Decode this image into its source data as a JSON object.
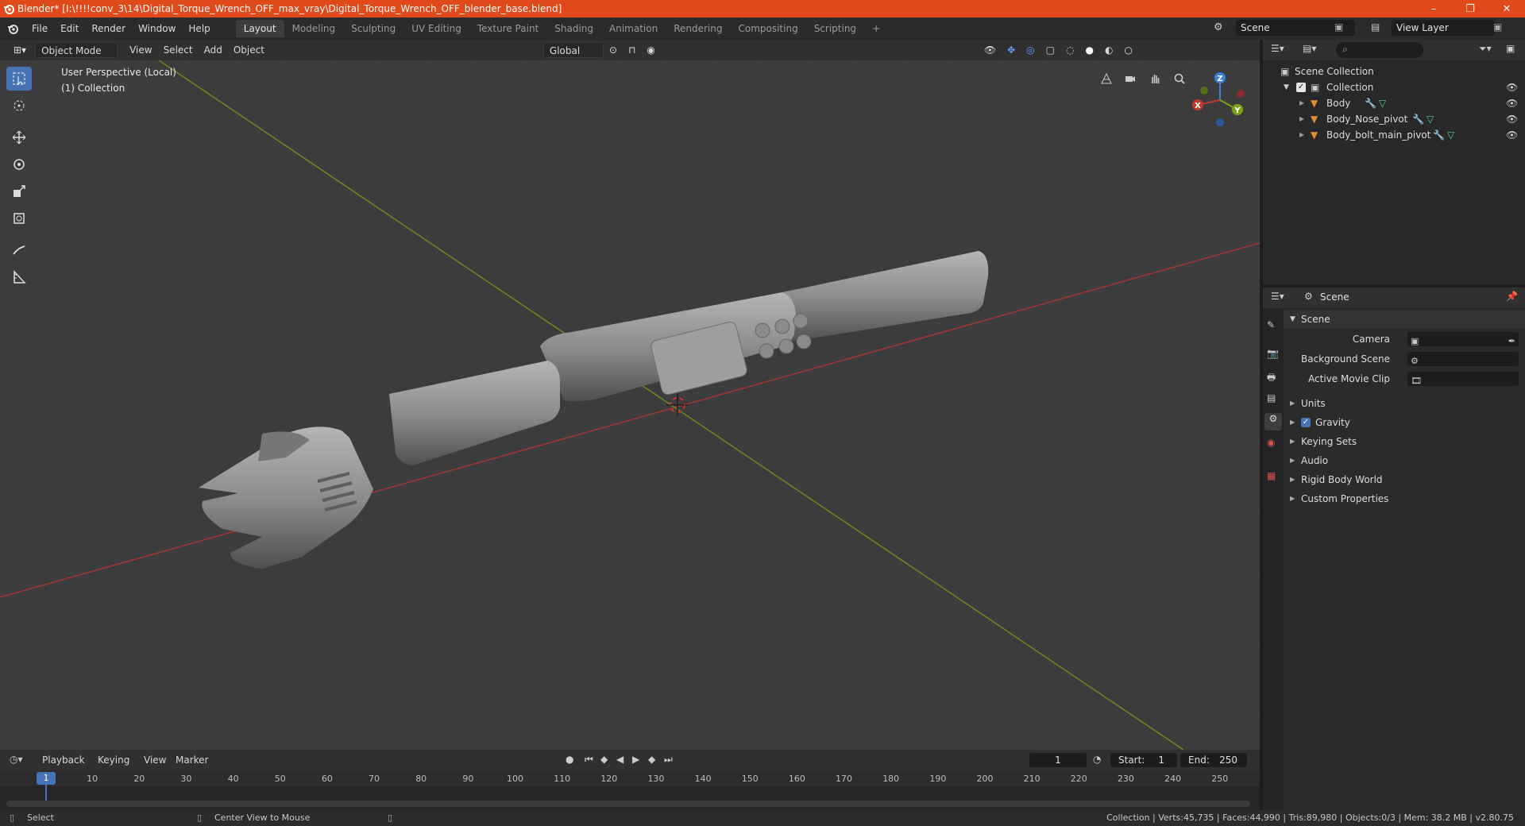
{
  "window": {
    "title": "Blender* [I:\\!!!!conv_3\\14\\Digital_Torque_Wrench_OFF_max_vray\\Digital_Torque_Wrench_OFF_blender_base.blend]",
    "controls": [
      "–",
      "❐",
      "✕"
    ]
  },
  "menu": [
    "File",
    "Edit",
    "Render",
    "Window",
    "Help"
  ],
  "workspaces": [
    "Layout",
    "Modeling",
    "Sculpting",
    "UV Editing",
    "Texture Paint",
    "Shading",
    "Animation",
    "Rendering",
    "Compositing",
    "Scripting"
  ],
  "active_workspace": "Layout",
  "scene_selector": "Scene",
  "view_layer": "View Layer",
  "viewport_header": {
    "mode": "Object Mode",
    "menus": [
      "View",
      "Select",
      "Add",
      "Object"
    ],
    "transform_orientation": "Global"
  },
  "viewport": {
    "perspective_label": "User Perspective (Local)",
    "collection_label": "(1) Collection",
    "gizmo_axes": [
      "X",
      "Y",
      "Z"
    ]
  },
  "outliner": {
    "root": "Scene Collection",
    "collection": "Collection",
    "objects": [
      "Body",
      "Body_Nose_pivot",
      "Body_bolt_main_pivot"
    ]
  },
  "properties": {
    "context": "Scene",
    "panel_title": "Scene",
    "fields": [
      {
        "label": "Camera"
      },
      {
        "label": "Background Scene"
      },
      {
        "label": "Active Movie Clip"
      }
    ],
    "sections": [
      "Units",
      "Gravity",
      "Keying Sets",
      "Audio",
      "Rigid Body World",
      "Custom Properties"
    ],
    "gravity_checked": true
  },
  "timeline": {
    "menus": [
      "Playback",
      "Keying",
      "View",
      "Marker"
    ],
    "current_frame": "1",
    "start_label": "Start:",
    "start": "1",
    "end_label": "End:",
    "end": "250",
    "ticks": [
      "1",
      "10",
      "20",
      "30",
      "40",
      "50",
      "60",
      "70",
      "80",
      "90",
      "100",
      "110",
      "120",
      "130",
      "140",
      "150",
      "160",
      "170",
      "180",
      "190",
      "200",
      "210",
      "220",
      "230",
      "240",
      "250"
    ]
  },
  "statusbar": {
    "left_action": "Select",
    "middle_action": "Center View to Mouse",
    "stats": "Collection | Verts:45,735 | Faces:44,990 | Tris:89,980 | Objects:0/3 | Mem: 38.2 MB | v2.80.75"
  },
  "colors": {
    "titlebar": "#e0491a",
    "accent": "#4772b3",
    "x_axis": "#c0392b",
    "y_axis": "#7ba31a",
    "z_axis": "#3f7fd9"
  }
}
